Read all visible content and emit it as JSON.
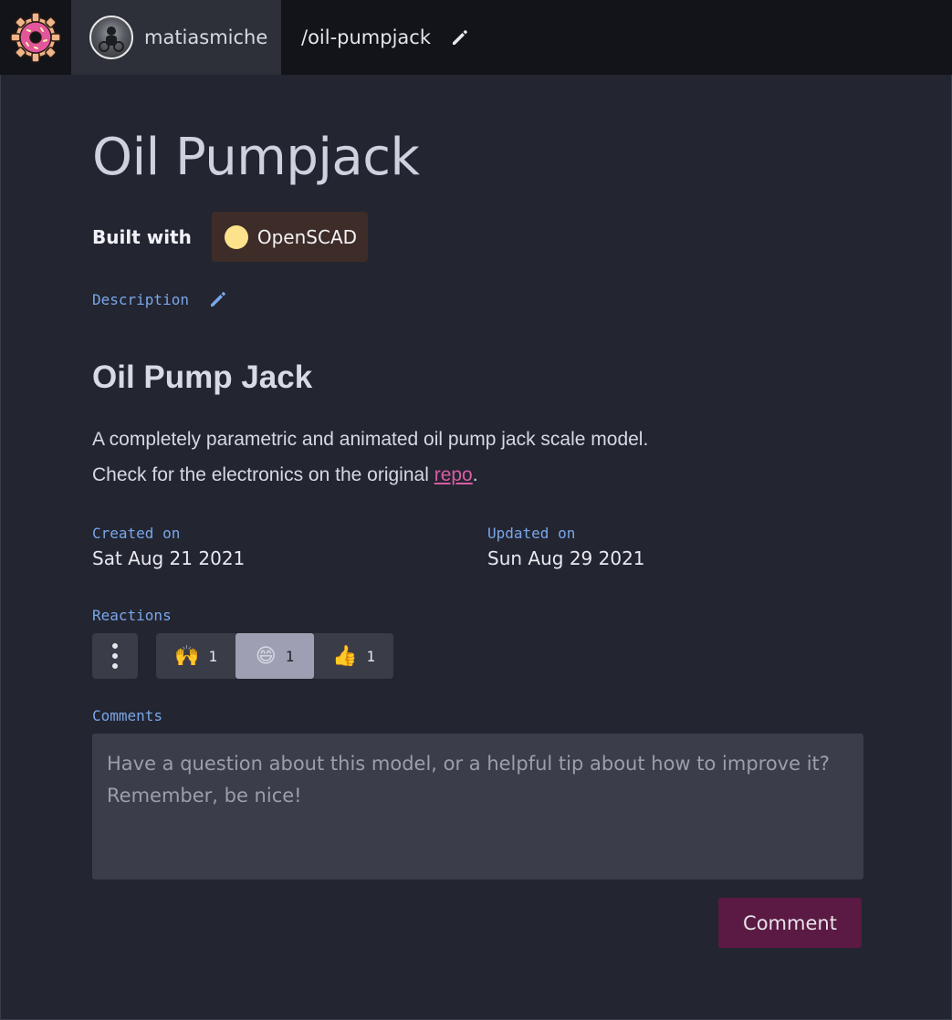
{
  "header": {
    "logo_icon": "donut-gear-logo",
    "username": "matiasmiche",
    "slug": "/oil-pumpjack"
  },
  "project": {
    "title": "Oil Pumpjack",
    "built_with_label": "Built with",
    "language": "OpenSCAD",
    "language_color": "#fce28b"
  },
  "description": {
    "label": "Description",
    "heading": "Oil Pump Jack",
    "line1": "A completely parametric and animated oil pump jack scale model.",
    "line2_prefix": "Check for the electronics on the original ",
    "link_text": "repo",
    "line2_suffix": "."
  },
  "dates": {
    "created_label": "Created on",
    "created_value": "Sat Aug 21 2021",
    "updated_label": "Updated on",
    "updated_value": "Sun Aug 29 2021"
  },
  "reactions": {
    "label": "Reactions",
    "items": [
      {
        "emoji": "🙌",
        "count": "1"
      },
      {
        "emoji": "😄",
        "count": "1"
      },
      {
        "emoji": "👍",
        "count": "1"
      }
    ]
  },
  "comments": {
    "label": "Comments",
    "placeholder": "Have a question about this model, or a helpful tip about how to improve it? Remember, be nice!",
    "button": "Comment"
  },
  "colors": {
    "accent_link": "#d95ca5",
    "label_blue": "#79a6ea",
    "comment_button": "#5a1a43"
  }
}
